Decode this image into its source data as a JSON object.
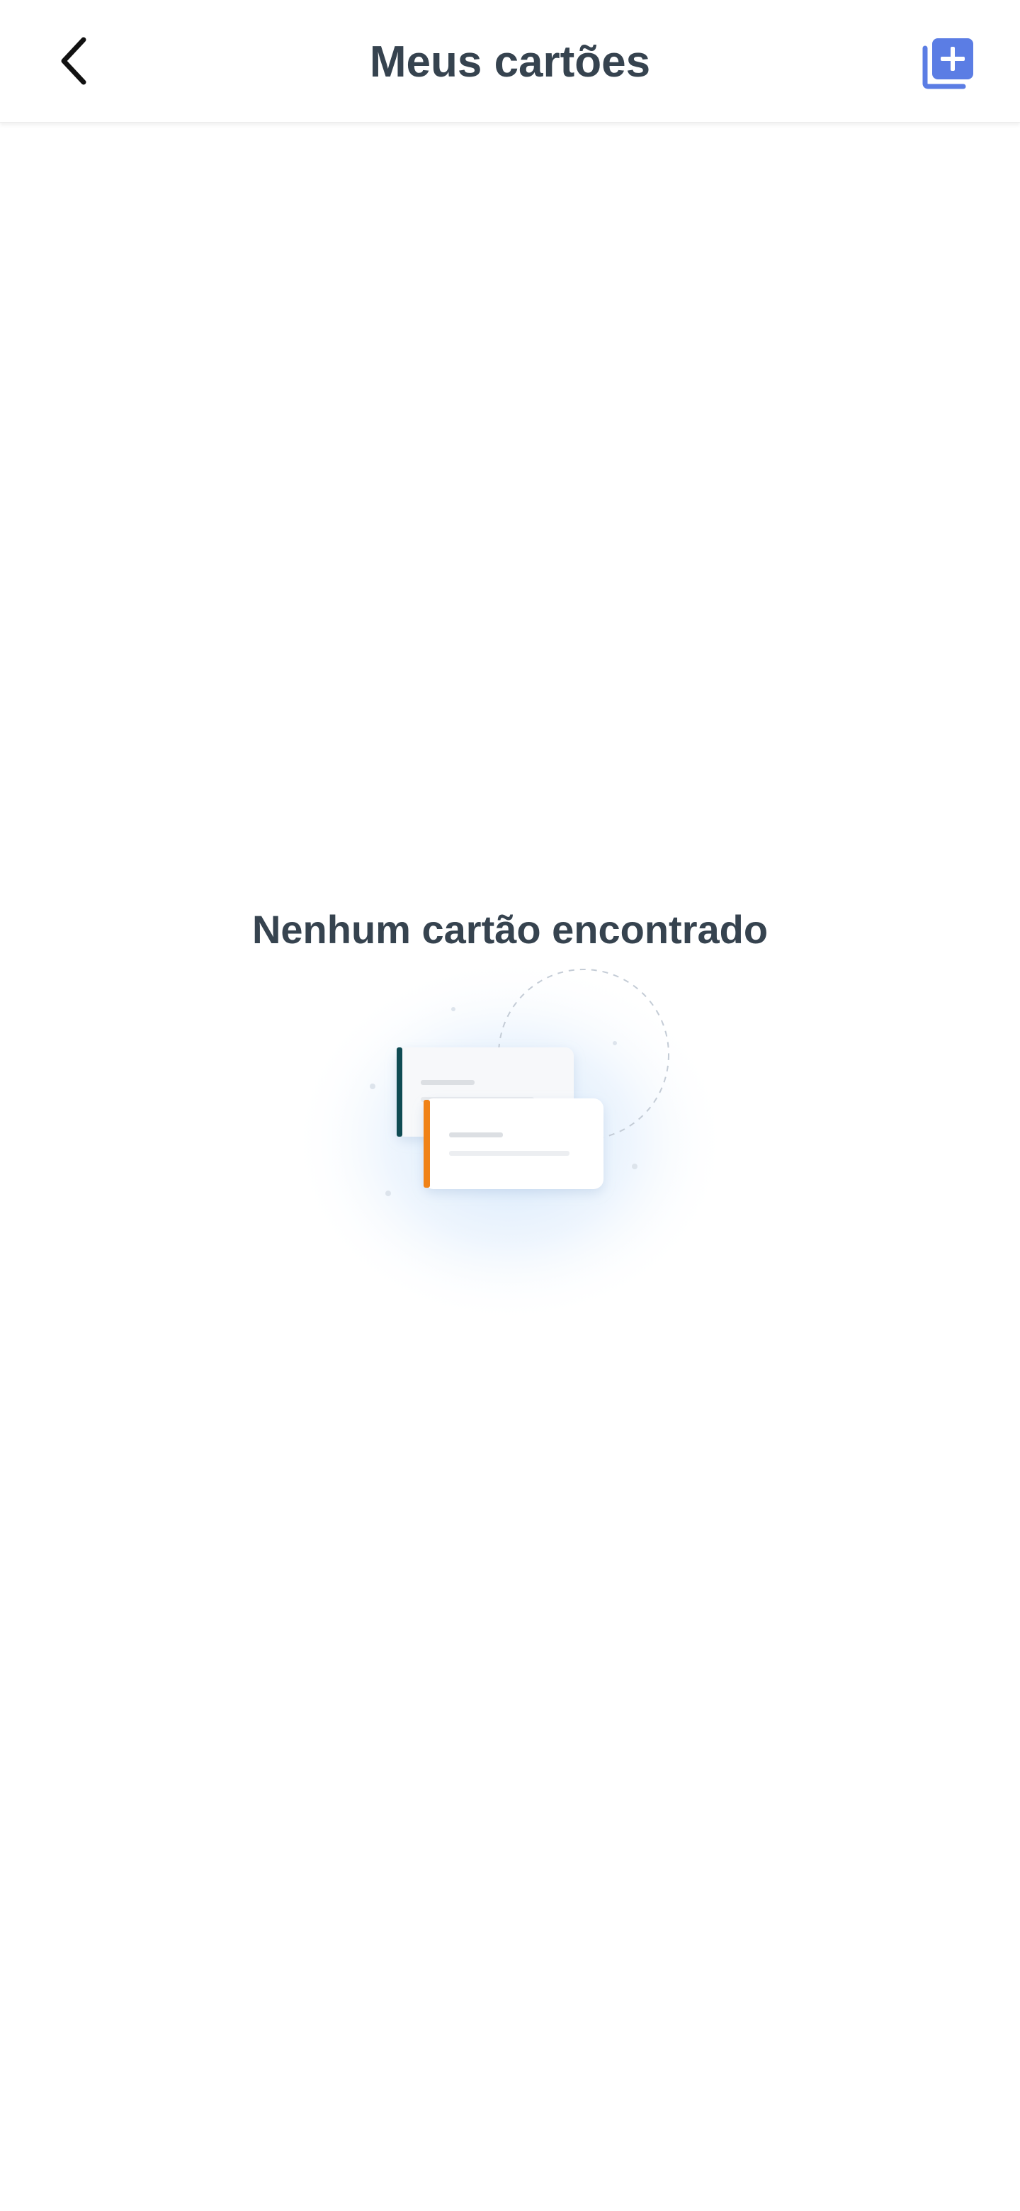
{
  "header": {
    "title": "Meus cartões",
    "back_icon": "chevron-left-icon",
    "add_icon": "library-add-icon",
    "accent_color": "#5b7de4"
  },
  "empty_state": {
    "message": "Nenhum cartão encontrado",
    "illustration": "cards-illustration",
    "card_accent_colors": [
      "#0f4b53",
      "#f08217"
    ]
  }
}
